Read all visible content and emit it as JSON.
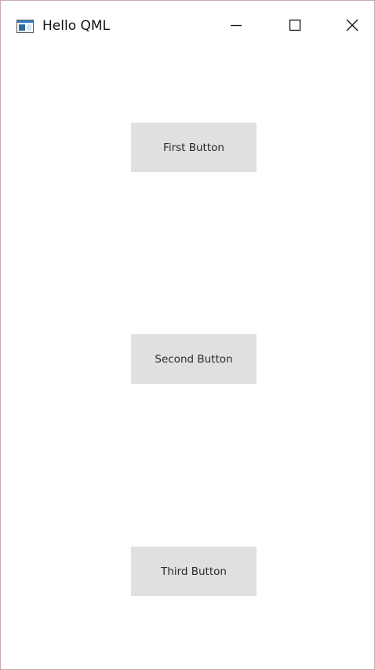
{
  "window": {
    "title": "Hello QML",
    "app_icon": "qt-window-icon",
    "controls": {
      "minimize_icon": "minimize-icon",
      "maximize_icon": "maximize-icon",
      "close_icon": "close-icon"
    }
  },
  "buttons": [
    {
      "label": "First Button"
    },
    {
      "label": "Second Button"
    },
    {
      "label": "Third Button"
    }
  ],
  "colors": {
    "button_background": "#e0e0e0",
    "window_border": "#c9a9ad",
    "background": "#ffffff"
  }
}
